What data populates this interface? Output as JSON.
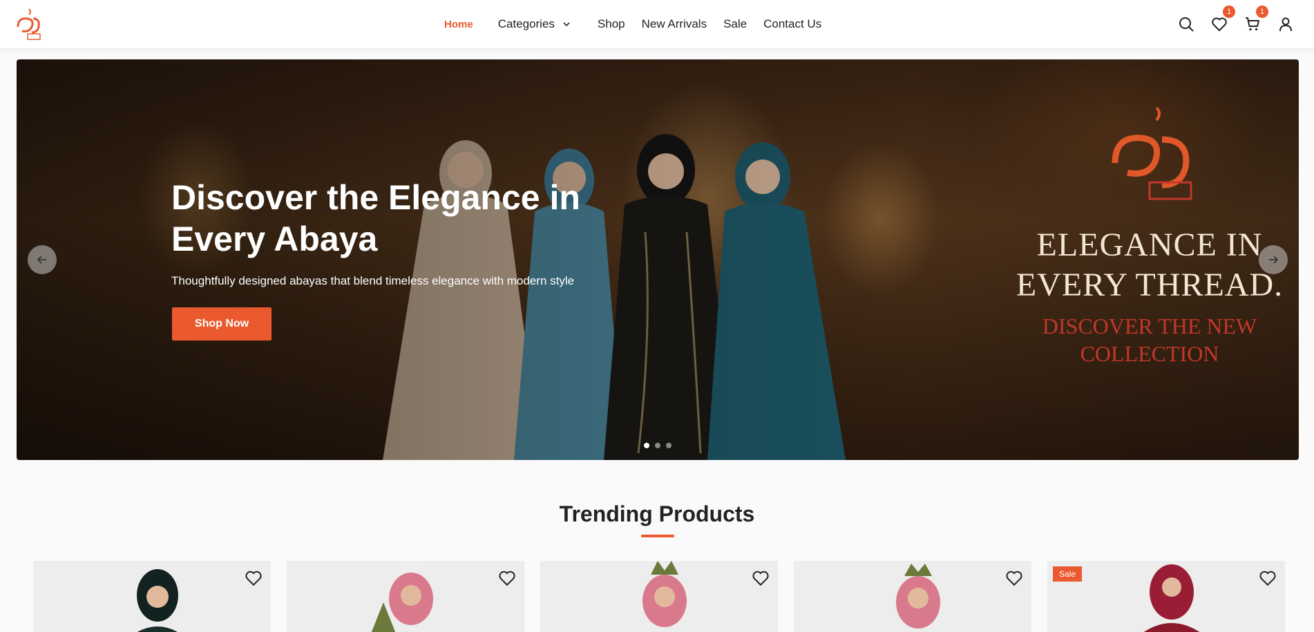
{
  "brand": {
    "logo_icon": "brand-logo-icon",
    "accent": "#ea5a2e"
  },
  "nav": {
    "home": "Home",
    "categories": "Categories",
    "shop": "Shop",
    "new_arrivals": "New Arrivals",
    "sale": "Sale",
    "contact": "Contact Us"
  },
  "header_icons": {
    "wishlist_count": "1",
    "cart_count": "1"
  },
  "hero": {
    "title": "Discover the Elegance in Every Abaya",
    "subtitle": "Thoughtfully designed abayas that blend timeless elegance with modern style",
    "cta": "Shop Now",
    "tagline_1": "ELEGANCE IN EVERY THREAD.",
    "tagline_2": "DISCOVER THE NEW COLLECTION",
    "slide_count": 3,
    "active_slide": 1
  },
  "trending": {
    "title": "Trending Products",
    "products": [
      {
        "badge": "",
        "robe_color": "#1a2e2c",
        "hijab_color": "#122220"
      },
      {
        "badge": "",
        "robe_color": "#6b7a3a",
        "hijab_color": "#d97a8c"
      },
      {
        "badge": "",
        "robe_color": "#6b7a3a",
        "hijab_color": "#d97a8c"
      },
      {
        "badge": "",
        "robe_color": "#6b7a3a",
        "hijab_color": "#d97a8c"
      },
      {
        "badge": "Sale",
        "robe_color": "#8a1a2c",
        "hijab_color": "#9a1d36"
      }
    ]
  }
}
